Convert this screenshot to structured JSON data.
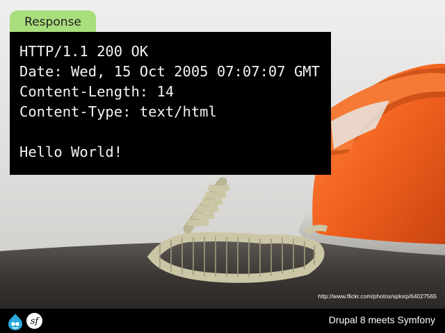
{
  "slide": {
    "tab_label": "Response",
    "code_lines": [
      "HTTP/1.1 200 OK",
      "Date: Wed, 15 Oct 2005 07:07:07 GMT",
      "Content-Length: 14",
      "Content-Type: text/html",
      "",
      "Hello World!"
    ],
    "photo_credit": "http://www.flickr.com/photos/splorp/64027565"
  },
  "footer": {
    "title": "Drupal 8 meets Symfony",
    "logos": [
      "drupal-logo-icon",
      "symfony-logo-icon"
    ],
    "symfony_logo_text": "sf"
  },
  "colors": {
    "tab_green": "#a9de7d",
    "code_bg": "#000000",
    "phone_orange": "#f2621f",
    "cord_color": "#cbc7a6"
  }
}
